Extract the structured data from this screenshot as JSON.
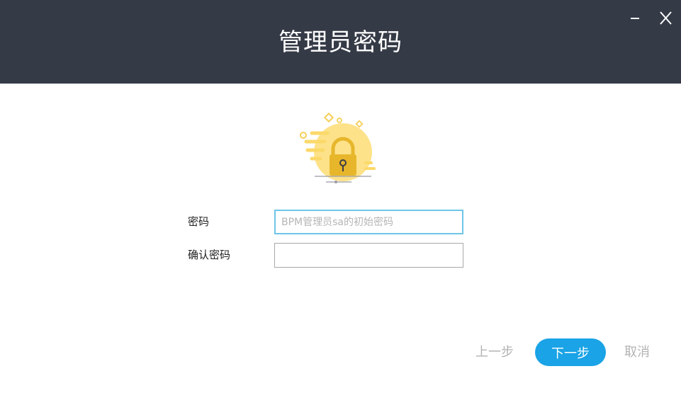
{
  "header": {
    "title": "管理员密码",
    "background": "#343a46",
    "minimize_icon": "minimize-icon",
    "close_icon": "close-icon"
  },
  "illustration": {
    "icon": "padlock-icon",
    "colors": {
      "circle": "#fde28a",
      "lock": "#e7b62a",
      "keyhole": "#3c3c48"
    }
  },
  "form": {
    "password": {
      "label": "密码",
      "value": "",
      "placeholder": "BPM管理员sa的初始密码"
    },
    "confirm": {
      "label": "确认密码",
      "value": "",
      "placeholder": ""
    }
  },
  "footer": {
    "prev_label": "上一步",
    "next_label": "下一步",
    "cancel_label": "取消",
    "accent": "#1aa3e6"
  }
}
